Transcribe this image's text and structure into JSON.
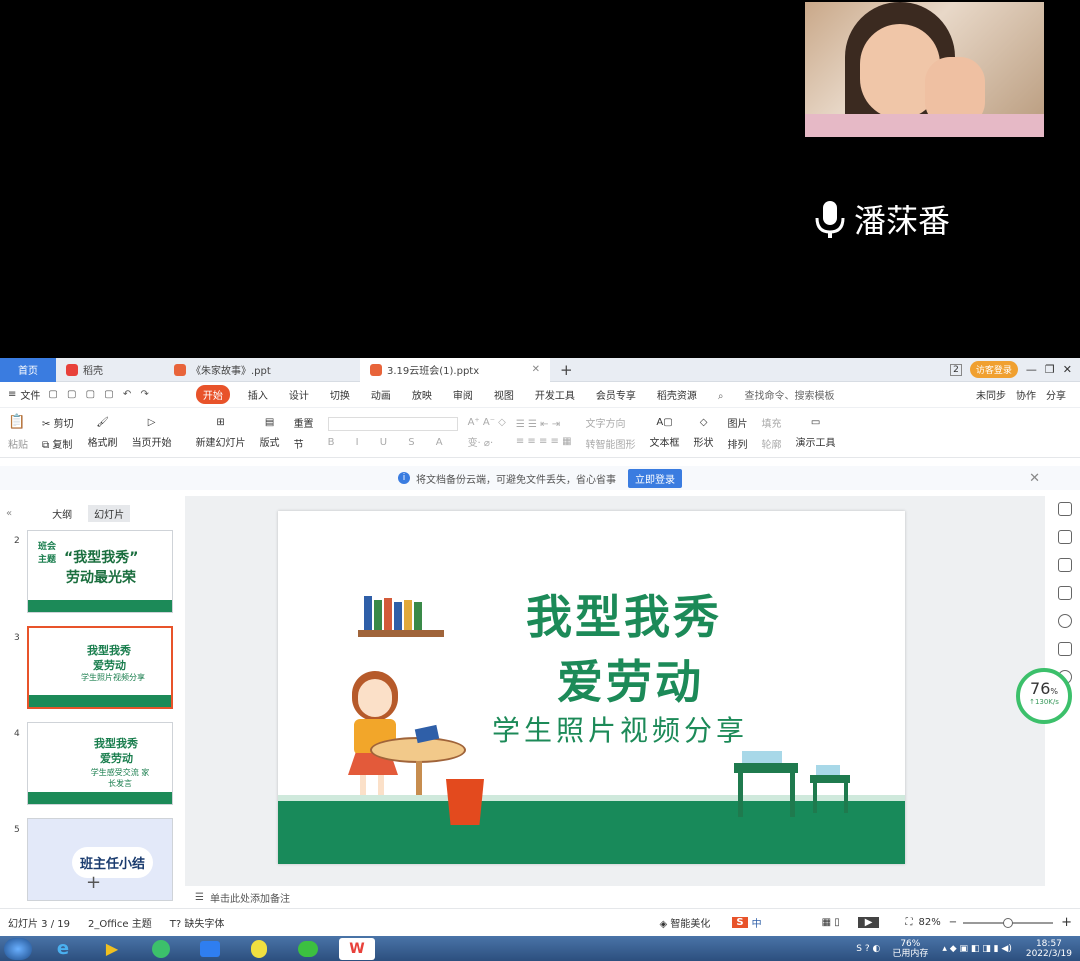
{
  "video_call": {
    "participant_name": "潘莯番"
  },
  "tabs": [
    {
      "label": "首页"
    },
    {
      "label": "稻壳"
    },
    {
      "label": "《朱家故事》.ppt"
    },
    {
      "label": "3.19云班会(1).pptx"
    }
  ],
  "tab_extras": {
    "badge": "2",
    "login": "访客登录"
  },
  "ribbon": {
    "file": "文件",
    "start": "开始",
    "items": [
      "插入",
      "设计",
      "切换",
      "动画",
      "放映",
      "审阅",
      "视图",
      "开发工具",
      "会员专享",
      "稻壳资源"
    ],
    "search": "查找命令、搜索模板",
    "sync": "未同步",
    "collab": "协作",
    "share": "分享"
  },
  "toolbar": {
    "paste": "粘贴",
    "cut": "剪切",
    "copy": "复制",
    "format": "格式刷",
    "play": "当页开始",
    "new_slide": "新建幻灯片",
    "layout": "版式",
    "section": "节",
    "reset": "重置",
    "textbox": "文本框",
    "shape": "形状",
    "arrange": "排列",
    "picture": "图片",
    "fill": "填充",
    "outline": "轮廓",
    "present": "演示工具",
    "convert": "转智能图形",
    "text_dir": "文字方向"
  },
  "notice": {
    "text": "将文档备份云端，可避免文件丢失，省心省事",
    "button": "立即登录"
  },
  "panel": {
    "tab_outline": "大纲",
    "tab_slides": "幻灯片",
    "add": "+"
  },
  "thumbnails": [
    {
      "num": "2",
      "tag": "班会主题",
      "title1": "“我型我秀”",
      "title2": "劳动最光荣"
    },
    {
      "num": "3",
      "title1": "我型我秀",
      "title2": "爱劳动",
      "sub": "学生照片视频分享"
    },
    {
      "num": "4",
      "title1": "我型我秀",
      "title2": "爱劳动",
      "sub": "学生感受交流 家长发言"
    },
    {
      "num": "5",
      "title1": "班主任小结"
    }
  ],
  "slide": {
    "line1": "我型我秀",
    "line2": "爱劳动",
    "line3": "学生照片视频分享"
  },
  "notes": "单击此处添加备注",
  "gauge": {
    "value": "76",
    "unit": "%",
    "speed": "↑130K/s"
  },
  "status": {
    "slide": "幻灯片 3 / 19",
    "theme": "2_Office 主题",
    "font": "缺失字体",
    "beautify": "智能美化",
    "zoom": "82%",
    "ime": "中"
  },
  "taskbar": {
    "mem_value": "76%",
    "mem_label": "已用内存",
    "time": "18:57",
    "date": "2022/3/19"
  }
}
